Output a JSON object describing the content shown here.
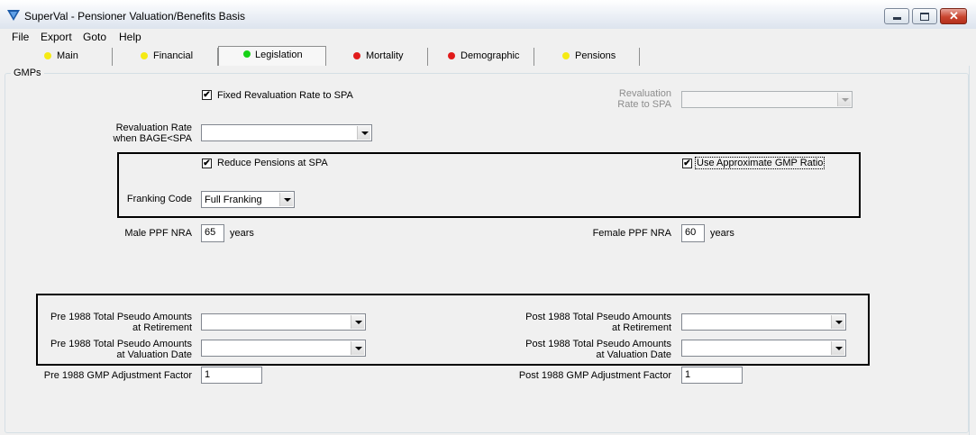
{
  "window": {
    "title": "SuperVal - Pensioner Valuation/Benefits Basis"
  },
  "menu": [
    "File",
    "Export",
    "Goto",
    "Help"
  ],
  "tabs": [
    {
      "label": "Main",
      "status_color": "#f5ea14"
    },
    {
      "label": "Financial",
      "status_color": "#f5ea14"
    },
    {
      "label": "Legislation",
      "status_color": "#17d217"
    },
    {
      "label": "Mortality",
      "status_color": "#e11b1b"
    },
    {
      "label": "Demographic",
      "status_color": "#e11b1b"
    },
    {
      "label": "Pensions",
      "status_color": "#f5ea14"
    }
  ],
  "group_title": "GMPs",
  "fields": {
    "fixed_reval": {
      "label": "Fixed Revaluation Rate to SPA",
      "checked": true
    },
    "reval_rate_to_spa": {
      "label_line1": "Revaluation",
      "label_line2": "Rate to SPA",
      "value": ""
    },
    "reval_rate_bage": {
      "label_line1": "Revaluation Rate",
      "label_line2": "when BAGE<SPA",
      "value": ""
    },
    "reduce_pensions": {
      "label": "Reduce Pensions at SPA",
      "checked": true
    },
    "approx_gmp": {
      "label": "Use Approximate GMP Ratio",
      "checked": true
    },
    "franking_code": {
      "label": "Franking Code",
      "value": "Full Franking"
    },
    "male_ppf_nra": {
      "label": "Male PPF NRA",
      "value": "65",
      "unit": "years"
    },
    "female_ppf_nra": {
      "label": "Female PPF NRA",
      "value": "60",
      "unit": "years"
    },
    "pre88_ret": {
      "label_line1": "Pre 1988 Total Pseudo Amounts",
      "label_line2": "at Retirement",
      "value": ""
    },
    "pre88_val": {
      "label_line1": "Pre 1988 Total Pseudo Amounts",
      "label_line2": "at Valuation Date",
      "value": ""
    },
    "post88_ret": {
      "label_line1": "Post 1988 Total Pseudo Amounts",
      "label_line2": "at Retirement",
      "value": ""
    },
    "post88_val": {
      "label_line1": "Post 1988 Total Pseudo Amounts",
      "label_line2": "at Valuation Date",
      "value": ""
    },
    "pre88_adj": {
      "label": "Pre 1988 GMP Adjustment Factor",
      "value": "1"
    },
    "post88_adj": {
      "label": "Post 1988 GMP Adjustment Factor",
      "value": "1"
    }
  },
  "icons": {
    "app": "superval-logo-icon",
    "check": "✔"
  }
}
